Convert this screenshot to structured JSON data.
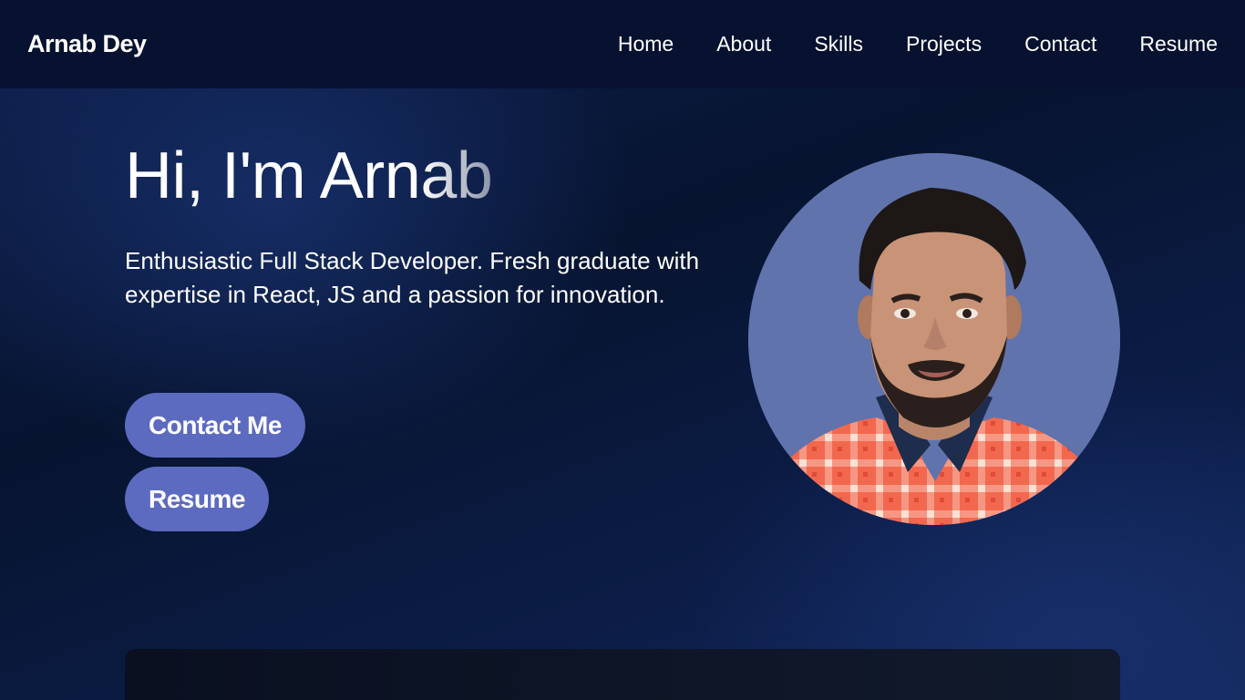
{
  "navbar": {
    "brand": "Arnab Dey",
    "links": [
      "Home",
      "About",
      "Skills",
      "Projects",
      "Contact",
      "Resume"
    ]
  },
  "hero": {
    "title_solid": "Hi, I'm Arn",
    "title_fade": "ab",
    "tagline": "Enthusiastic Full Stack Developer. Fresh graduate with expertise in React, JS and a passion for innovation.",
    "contact_button": "Contact Me",
    "resume_button": "Resume"
  },
  "colors": {
    "navbar_bg": "#061230",
    "button_bg": "#5c6bc0",
    "avatar_bg": "#6073ad",
    "page_bg": "#0c1d48"
  },
  "icons": {
    "avatar": "profile-photo"
  }
}
